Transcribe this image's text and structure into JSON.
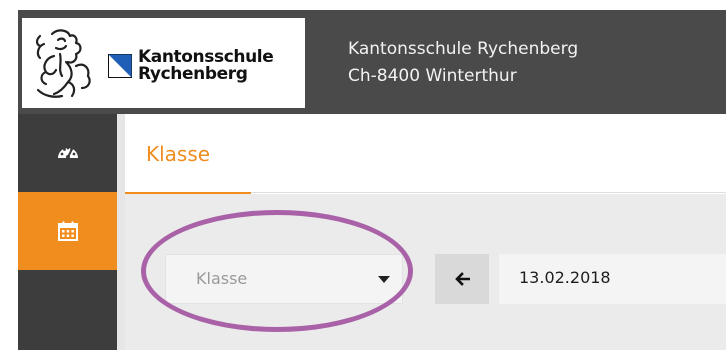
{
  "header": {
    "logo": {
      "line1": "Kantonsschule",
      "line2": "Rychenberg",
      "icon": "zurich-lion-emblem",
      "flag_icon": "canton-zurich-flag"
    },
    "school_name": "Kantonsschule Rychenberg",
    "school_address": "Ch-8400 Winterthur"
  },
  "sidebar": {
    "items": [
      {
        "icon": "dashboard-gauge-icon",
        "active": false
      },
      {
        "icon": "calendar-icon",
        "active": true
      }
    ]
  },
  "main": {
    "tabs": [
      {
        "label": "Klasse",
        "active": true
      }
    ],
    "filters": {
      "class_select": {
        "placeholder": "Klasse"
      },
      "prev_button": {
        "icon": "arrow-left-icon"
      },
      "date": {
        "value": "13.02.2018"
      }
    }
  },
  "colors": {
    "header_bg": "#4a4a4a",
    "accent": "#f08d1f",
    "sidebar_bg": "#3d3d3d",
    "highlight_ring": "#a962a8"
  }
}
